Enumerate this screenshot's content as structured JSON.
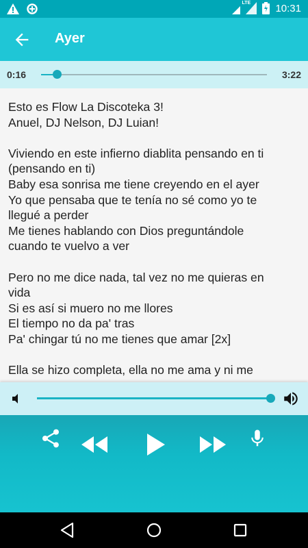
{
  "status_bar": {
    "time": "10:31",
    "network": "LTE",
    "icons": [
      "warning-icon",
      "data-saver-icon",
      "wifi-icon",
      "lte-signal-icon",
      "battery-charging-icon"
    ]
  },
  "app_bar": {
    "title": "Ayer",
    "back_icon": "arrow-back-icon"
  },
  "player": {
    "current_time": "0:16",
    "total_time": "3:22",
    "progress_fraction": 0.07,
    "volume_fraction": 1.0
  },
  "lyrics": {
    "lines": [
      "Esto es Flow La Discoteka 3!",
      "Anuel, DJ Nelson, DJ Luian!",
      "",
      "Viviendo en este infierno diablita pensando en ti",
      "(pensando en ti)",
      "Baby esa sonrisa me tiene creyendo en el ayer",
      "Yo que pensaba que te tenía no sé como yo te",
      "llegué a perder",
      "Me tienes hablando con Dios preguntándole",
      "cuando te vuelvo a ver",
      "",
      "Pero no me dice nada, tal vez no me quieras en",
      "vida",
      "Si es así si muero no me llores",
      "El tiempo no da pa' tras",
      "Pa' chingar tú no me tienes que amar [2x]",
      "",
      "Ella se hizo completa, ella no me ama y ni me"
    ]
  },
  "controls": {
    "icons": [
      "share-icon",
      "rewind-icon",
      "play-icon",
      "fast-forward-icon",
      "microphone-icon"
    ]
  },
  "colors": {
    "status_bar": "#00a7b7",
    "app_bar": "#1fc6d6",
    "seek_bar_bg": "#ccf1f5",
    "accent": "#17a9ba",
    "controls_bg": "#12b9c7"
  }
}
